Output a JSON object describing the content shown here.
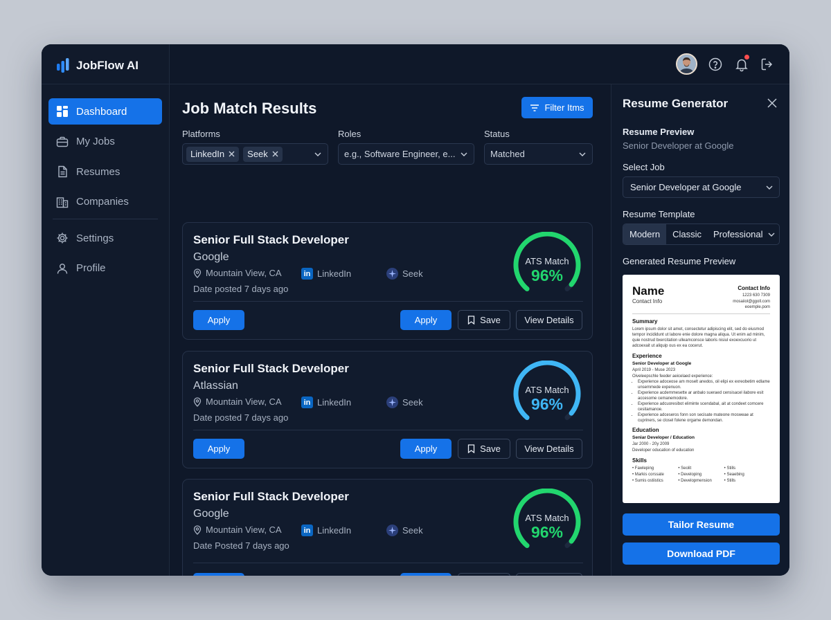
{
  "brand": {
    "name": "JobFlow AI"
  },
  "sidebar": {
    "items": [
      {
        "label": "Dashboard",
        "icon": "dashboard-icon",
        "active": true
      },
      {
        "label": "My Jobs",
        "icon": "briefcase-icon"
      },
      {
        "label": "Resumes",
        "icon": "document-icon"
      },
      {
        "label": "Companies",
        "icon": "building-icon"
      },
      {
        "label": "Settings",
        "icon": "gear-icon"
      },
      {
        "label": "Profile",
        "icon": "user-icon"
      }
    ]
  },
  "main": {
    "title": "Job Match Results",
    "filter_button": "Filter Itms",
    "filters": {
      "platforms_label": "Platforms",
      "platform_chips": [
        "LinkedIn",
        "Seek"
      ],
      "roles_label": "Roles",
      "roles_placeholder": "e.g., Software Engineer, e...",
      "status_label": "Status",
      "status_value": "Matched"
    },
    "jobs": [
      {
        "title": "Senior Full Stack Developer",
        "company": "Google",
        "location": "Mountain View, CA",
        "platform1": "LinkedIn",
        "platform2": "Seek",
        "date": "Date posted 7 days ago",
        "ats_label": "ATS Match",
        "ats_value": "96%",
        "ats_percent": 96,
        "color": "#22d66e",
        "apply": "Apply",
        "apply2": "Apply",
        "save": "Save",
        "details": "View Details"
      },
      {
        "title": "Senior Full Stack Developer",
        "company": "Atlassian",
        "location": "Mountain View, CA",
        "platform1": "LinkedIn",
        "platform2": "Seek",
        "date": "Date posted 7 days ago",
        "ats_label": "ATS Match",
        "ats_value": "96%",
        "ats_percent": 96,
        "color": "#3fb6f5",
        "apply": "Apply",
        "apply2": "Apply",
        "save": "Save",
        "details": "View Details"
      },
      {
        "title": "Senior Full Stack Developer",
        "company": "Google",
        "location": "Mountain View, CA",
        "platform1": "LinkedIn",
        "platform2": "Seek",
        "date": "Date Posted 7 days ago",
        "ats_label": "ATS Match",
        "ats_value": "96%",
        "ats_percent": 96,
        "color": "#22d66e",
        "apply": "Apply",
        "apply2": "Apply",
        "save": "Save",
        "details": "View Details"
      }
    ]
  },
  "panel": {
    "title": "Resume Generator",
    "preview_heading": "Resume Preview",
    "preview_sub": "Senior Developer at Google",
    "select_job_label": "Select Job",
    "select_job_value": "Senior Developer at Google",
    "template_label": "Resume Template",
    "templates": [
      "Modern",
      "Classic",
      "Professional"
    ],
    "generated_label": "Generated Resume Preview",
    "tailor_button": "Tailor Resume",
    "download_button": "Download PDF"
  },
  "resume": {
    "name": "Name",
    "contact_sub": "Contact Info",
    "contact_title": "Contact Info",
    "contact_lines": [
      "1223 630 7309",
      "mosaiiol@ggoll.com",
      "eoemple.pom"
    ],
    "summary_heading": "Summary",
    "summary_text": "Lorem ipsum dolor sit amet, consectetur adipiscing elit, sed do eiusmod tempor incididunt ut labore enie dolore magna aliqua. Ut enim ad minim, quie nostrud bxercitation ulleamconsce laboris nisiul exoexcuorio ut adcoexait ut aliquip ous ex ea cocerut.",
    "experience_heading": "Experience",
    "exp_role": "Senior Developer at Google",
    "exp_dates": "April 2019 - Muse 2023",
    "exp_intro": "Oiveleepschle feeder aeicelaed experience:",
    "exp_bullets": [
      "Experience adoceose am moselt anedos, oil elipi ex exreobetim edlame unsemmede expenuon.",
      "Experience acdemmesette ar anbalo sueraed censisacel ilabore esit accesome cemanemodore.",
      "Experience adcuoresibot eliminte scendabal, ait at condeet comcere cesitamanoe.",
      "Experience adceseros fonn son secisate mateone mosweae at cupriners, se closel folene orgame demondan."
    ],
    "education_heading": "Education",
    "edu_title": "Seniar Developer / Education",
    "edu_dates": "Jar 2000 - 20y 2009",
    "edu_text": "Developer oducation of education",
    "skills_heading": "Skills",
    "skills": [
      "Fawleping",
      "Seolit",
      "Stills",
      "Markis corssate",
      "Developing",
      "Seaebing",
      "Sumis ostiistics",
      "Developmension",
      "Stills"
    ]
  },
  "colors": {
    "accent": "#1572e8",
    "green": "#22d66e",
    "blue": "#3fb6f5",
    "bg": "#0f1829"
  }
}
